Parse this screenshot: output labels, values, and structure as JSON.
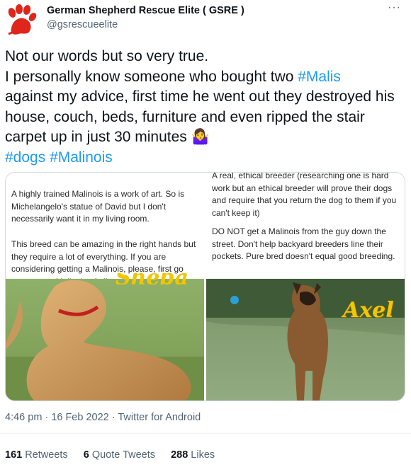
{
  "author": {
    "name": "German Shepherd Rescue Elite ( GSRE )",
    "handle": "@gsrescueelite",
    "avatar_icon": "paw-print-icon",
    "avatar_color": "#e0251b"
  },
  "menu_icon": "more-options-icon",
  "tweet": {
    "line1": "Not our words but so very true.",
    "line2_prefix": "I personally know someone who bought two ",
    "hashtag_malis": "#Malis",
    "line3": "against my advice, first time he went out they destroyed his house, couch, beds, furniture and even ripped the stair carpet up in just  30 minutes",
    "emoji": "🤷‍♀️",
    "hashtag_dogs": "#dogs",
    "hashtag_malinois": "#Malinois",
    "hashtag_color": "#1d9bf0"
  },
  "media": {
    "left": {
      "para1": "A highly trained Malinois is a work of art. So is Michelangelo's statue of David but I don't necessarily want it in my living room.",
      "para2": "This breed can be amazing in the right hands but they require a lot of everything. If you are considering getting a Malinois, please, first go meet some Malinois of all",
      "dog_name_partial": "Sheba"
    },
    "right": {
      "para1": "A real, ethical breeder (researching one is hard work but an ethical breeder will prove their dogs and require that you return the dog to them if you can't keep it)",
      "para2": "DO NOT get a Malinois from the guy down the street. Don't help backyard breeders line their pockets. Pure bred doesn't equal good breeding.",
      "dog_name": "Axel"
    }
  },
  "meta": {
    "time": "4:46 pm",
    "date": "16 Feb 2022",
    "source": "Twitter for Android"
  },
  "stats": {
    "retweets_count": "161",
    "retweets_label": "Retweets",
    "quotes_count": "6",
    "quotes_label": "Quote Tweets",
    "likes_count": "288",
    "likes_label": "Likes"
  }
}
